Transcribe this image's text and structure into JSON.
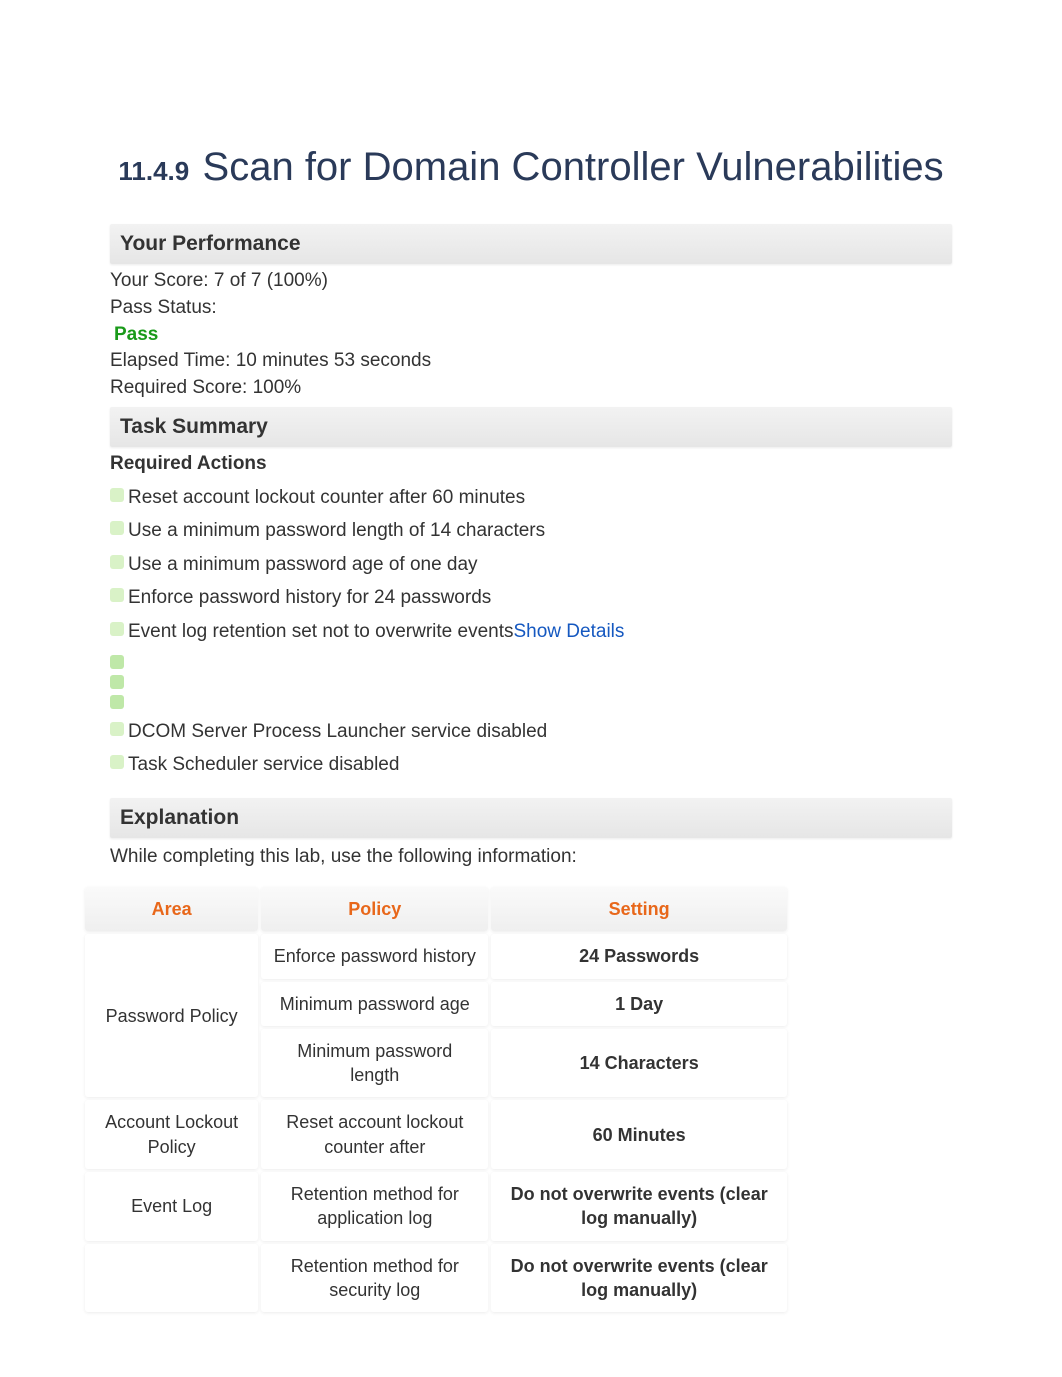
{
  "title": {
    "number": "11.4.9",
    "text": "Scan for Domain Controller Vulnerabilities"
  },
  "performance": {
    "header": "Your Performance",
    "score_label": "Your Score:",
    "score_value": "7 of 7 (100%)",
    "pass_status_label": "Pass Status:",
    "pass_status_value": "Pass",
    "elapsed_label": "Elapsed Time:",
    "elapsed_value": "10 minutes 53 seconds",
    "required_label": "Required Score:",
    "required_value": "100%"
  },
  "task_summary": {
    "header": "Task Summary",
    "subhead": "Required Actions",
    "actions": [
      "Reset account lockout counter after 60 minutes",
      "Use a minimum password length of 14 characters",
      "Use a minimum password age of one day",
      "Enforce password history for 24 passwords",
      "Event log retention set not to overwrite events",
      "DCOM Server Process Launcher service disabled",
      "Task Scheduler service disabled"
    ],
    "show_details": "Show Details"
  },
  "explanation": {
    "header": "Explanation",
    "intro": "While completing this lab, use the following information:",
    "columns": {
      "area": "Area",
      "policy": "Policy",
      "setting": "Setting"
    },
    "rows": [
      {
        "area": "Password Policy",
        "policy": "Enforce password history",
        "setting": "24 Passwords",
        "rowspan": 3
      },
      {
        "area": "",
        "policy": "Minimum password age",
        "setting": "1 Day"
      },
      {
        "area": "",
        "policy": "Minimum password length",
        "setting": "14 Characters"
      },
      {
        "area": "Account Lockout Policy",
        "policy": "Reset account lockout counter after",
        "setting": "60 Minutes",
        "rowspan": 1
      },
      {
        "area": "Event Log",
        "policy": "Retention method for application log",
        "setting": "Do not overwrite events (clear log manually)",
        "rowspan": 1
      },
      {
        "area": "",
        "policy": "Retention method for security log",
        "setting": "Do not overwrite events (clear log manually)"
      }
    ]
  }
}
